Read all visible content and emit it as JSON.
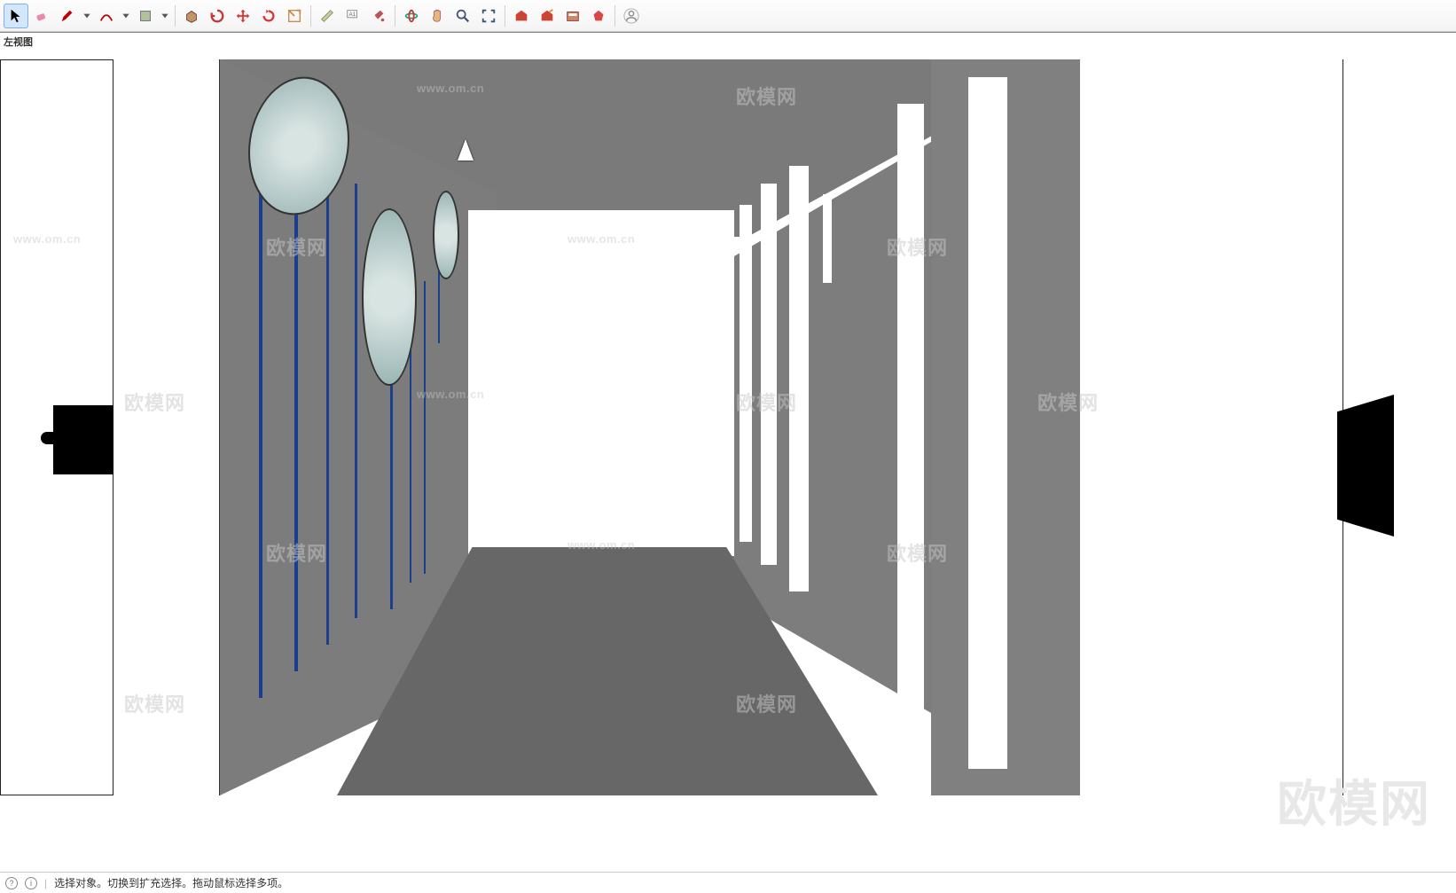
{
  "toolbar": {
    "tools": [
      {
        "name": "select-tool",
        "icon": "cursor",
        "color": "#000",
        "active": true
      },
      {
        "name": "eraser-tool",
        "icon": "eraser",
        "color": "#e78bb5"
      },
      {
        "name": "pencil-tool",
        "icon": "pencil",
        "color": "#b00"
      },
      {
        "name": "dropdown-1",
        "icon": "chev",
        "color": "#555"
      },
      {
        "name": "arc-tool",
        "icon": "arc",
        "color": "#b00"
      },
      {
        "name": "dropdown-2",
        "icon": "chev",
        "color": "#555"
      },
      {
        "name": "rect-tool",
        "icon": "rect",
        "color": "#9a8"
      },
      {
        "name": "dropdown-3",
        "icon": "chev",
        "color": "#555"
      },
      {
        "sep": true
      },
      {
        "name": "pushpull-tool",
        "icon": "box",
        "color": "#b55"
      },
      {
        "name": "follow-tool",
        "icon": "swirl",
        "color": "#c33"
      },
      {
        "name": "move-tool",
        "icon": "move",
        "color": "#d33"
      },
      {
        "name": "rotate-tool",
        "icon": "rotate",
        "color": "#d33"
      },
      {
        "name": "scale-tool",
        "icon": "scale",
        "color": "#c84"
      },
      {
        "sep": true
      },
      {
        "name": "tape-tool",
        "icon": "tape",
        "color": "#aa8"
      },
      {
        "name": "text-tool",
        "icon": "text",
        "color": "#888"
      },
      {
        "name": "paint-tool",
        "icon": "bucket",
        "color": "#b55"
      },
      {
        "sep": true
      },
      {
        "name": "orbit-tool",
        "icon": "orbit",
        "color": "#2a7"
      },
      {
        "name": "pan-tool",
        "icon": "hand",
        "color": "#d9a04a"
      },
      {
        "name": "zoom-tool",
        "icon": "zoom",
        "color": "#457"
      },
      {
        "name": "zoom-extents-tool",
        "icon": "extents",
        "color": "#357"
      },
      {
        "sep": true
      },
      {
        "name": "warehouse-1",
        "icon": "wh",
        "color": "#c43"
      },
      {
        "name": "warehouse-2",
        "icon": "wh2",
        "color": "#c43"
      },
      {
        "name": "warehouse-3",
        "icon": "wh3",
        "color": "#c43"
      },
      {
        "name": "extension-tool",
        "icon": "gem",
        "color": "#c43"
      },
      {
        "sep": true
      },
      {
        "name": "user-tool",
        "icon": "user",
        "color": "#888"
      }
    ]
  },
  "viewport": {
    "label": "左视图"
  },
  "watermarks": {
    "text": "欧模网",
    "url": "www.om.cn",
    "brand": "欧模网"
  },
  "statusbar": {
    "hint": "选择对象。切换到扩充选择。拖动鼠标选择多项。"
  }
}
